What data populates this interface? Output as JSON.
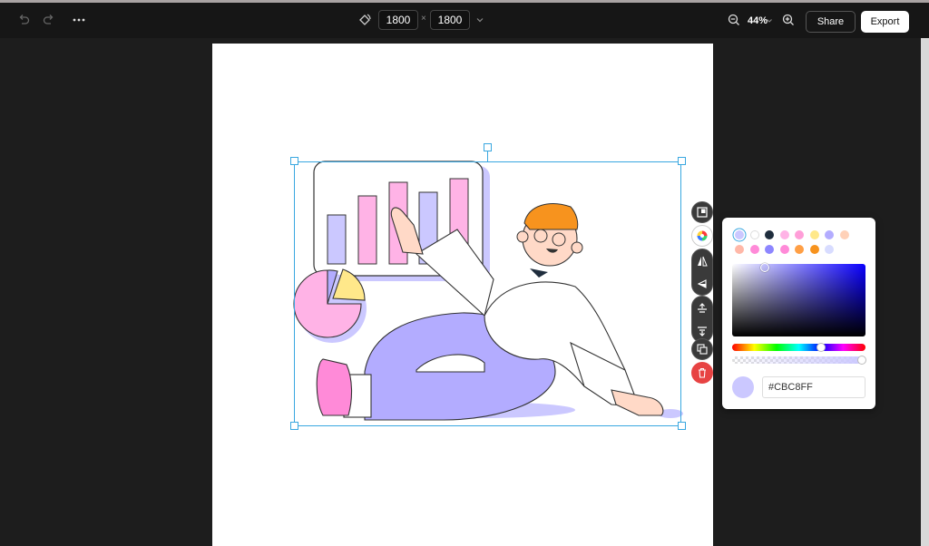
{
  "toolbar": {
    "width_value": "1800",
    "height_value": "1800",
    "times_symbol": "×",
    "zoom": "44%",
    "share_label": "Share",
    "export_label": "Export"
  },
  "color_picker": {
    "hex_value": "#CBC8FF",
    "selected_color": "#cbc8ff",
    "palette_row1": [
      "#cbc8ff",
      "#ffffff",
      "#1f2d3d",
      "#ffb3e6",
      "#ff9ed8",
      "#ffe88a",
      "#b3acff",
      "#ffd1b8"
    ],
    "palette_row2": [
      "#ffb8a8",
      "#ff8ad8",
      "#8d86ff",
      "#ff8ad8",
      "#ff9f45",
      "#f7931e",
      "#d8dcff"
    ]
  },
  "icons": [
    "undo-icon",
    "redo-icon",
    "more-icon",
    "rotate-icon",
    "chevron-down-icon",
    "zoom-out-icon",
    "zoom-in-icon",
    "replace-image-icon",
    "color-wheel-icon",
    "flip-horizontal-icon",
    "flip-vertical-icon",
    "bring-forward-icon",
    "send-backward-icon",
    "duplicate-icon",
    "delete-icon"
  ]
}
